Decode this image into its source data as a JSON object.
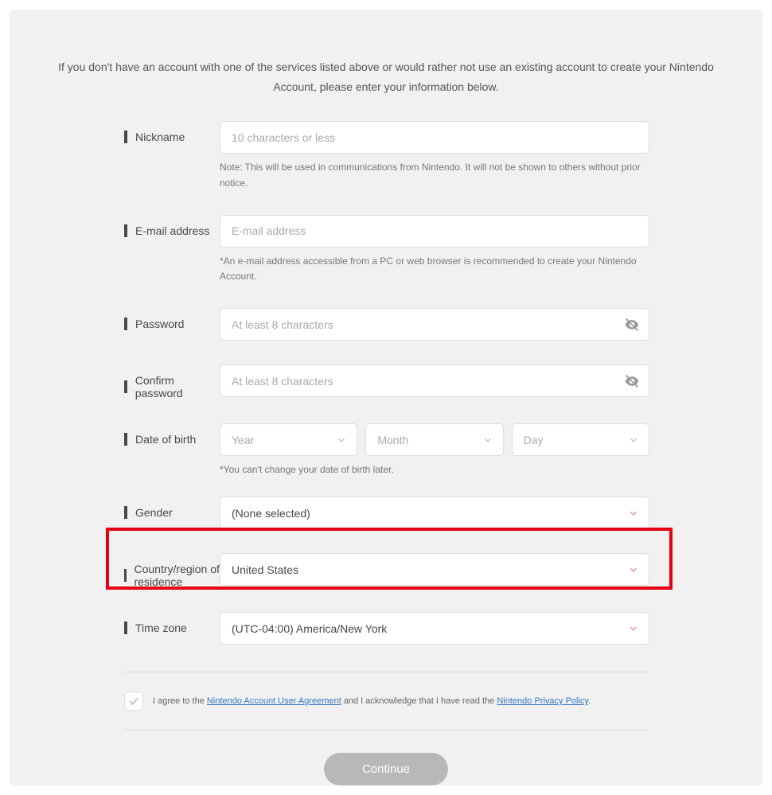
{
  "intro": "If you don't have an account with one of the services listed above or would rather not use an existing account to create your Nintendo Account, please enter your information below.",
  "fields": {
    "nickname": {
      "label": "Nickname",
      "placeholder": "10 characters or less",
      "note": "Note: This will be used in communications from Nintendo. It will not be shown to others without prior notice."
    },
    "email": {
      "label": "E-mail address",
      "placeholder": "E-mail address",
      "note": "*An e-mail address accessible from a PC or web browser is recommended to create your Nintendo Account."
    },
    "password": {
      "label": "Password",
      "placeholder": "At least 8 characters"
    },
    "confirm": {
      "label": "Confirm password",
      "placeholder": "At least 8 characters"
    },
    "dob": {
      "label": "Date of birth",
      "year": "Year",
      "month": "Month",
      "day": "Day",
      "note": "*You can't change your date of birth later."
    },
    "gender": {
      "label": "Gender",
      "value": "(None selected)"
    },
    "country": {
      "label": "Country/region of residence",
      "value": "United States"
    },
    "timezone": {
      "label": "Time zone",
      "value": "(UTC-04:00) America/New York"
    }
  },
  "agree": {
    "pre": "I agree to the ",
    "link1": "Nintendo Account User Agreement",
    "mid": " and I acknowledge that I have read the ",
    "link2": "Nintendo Privacy Policy",
    "post": "."
  },
  "continue": "Continue"
}
